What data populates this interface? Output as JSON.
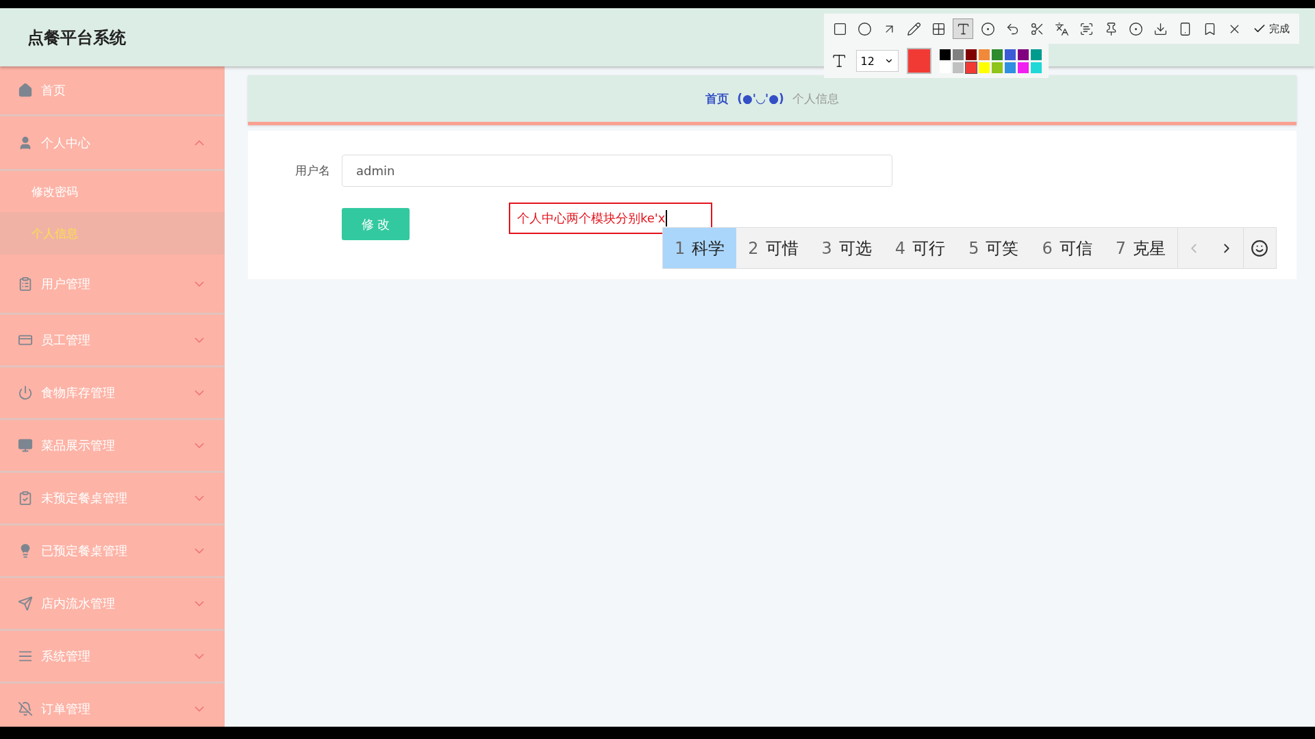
{
  "app": {
    "title": "点餐平台系统"
  },
  "sidebar": {
    "items": [
      {
        "label": "首页",
        "expanded": false
      },
      {
        "label": "个人中心",
        "expanded": true,
        "children": [
          {
            "label": "修改密码",
            "selected": false
          },
          {
            "label": "个人信息",
            "selected": true
          }
        ]
      },
      {
        "label": "用户管理",
        "expanded": false
      },
      {
        "label": "员工管理",
        "expanded": false
      },
      {
        "label": "食物库存管理",
        "expanded": false
      },
      {
        "label": "菜品展示管理",
        "expanded": false
      },
      {
        "label": "未预定餐桌管理",
        "expanded": false
      },
      {
        "label": "已预定餐桌管理",
        "expanded": false
      },
      {
        "label": "店内流水管理",
        "expanded": false
      },
      {
        "label": "系统管理",
        "expanded": false
      },
      {
        "label": "订单管理",
        "expanded": false
      }
    ]
  },
  "breadcrumb": {
    "home": "首页",
    "separator": "(●'◡'●)",
    "current": "个人信息"
  },
  "form": {
    "label": "用户名",
    "value": "admin",
    "button": "修 改"
  },
  "annotation": {
    "text": "个人中心两个模块分别ke'x"
  },
  "ime": {
    "candidates": [
      {
        "index": "1",
        "text": "科学",
        "selected": true
      },
      {
        "index": "2",
        "text": "可惜",
        "selected": false
      },
      {
        "index": "3",
        "text": "可选",
        "selected": false
      },
      {
        "index": "4",
        "text": "可行",
        "selected": false
      },
      {
        "index": "5",
        "text": "可笑",
        "selected": false
      },
      {
        "index": "6",
        "text": "可信",
        "selected": false
      },
      {
        "index": "7",
        "text": "克星",
        "selected": false
      }
    ]
  },
  "capture_toolbar": {
    "tools": [
      {
        "selected": false
      },
      {
        "selected": false
      },
      {
        "selected": false
      },
      {
        "selected": false
      },
      {
        "selected": false
      },
      {
        "selected": true
      },
      {
        "selected": false
      }
    ],
    "done": "完成",
    "font_size": "12",
    "swatches": [
      {
        "color": "#000000",
        "selected": false
      },
      {
        "color": "#808080",
        "selected": false
      },
      {
        "color": "#800000",
        "selected": false
      },
      {
        "color": "#f08a3a",
        "selected": false
      },
      {
        "color": "#2e8b2e",
        "selected": false
      },
      {
        "color": "#3b5bd6",
        "selected": false
      },
      {
        "color": "#800080",
        "selected": false
      },
      {
        "color": "#009b8f",
        "selected": false
      },
      {
        "color": "#ffffff",
        "selected": false
      },
      {
        "color": "#c0c0c0",
        "selected": false
      },
      {
        "color": "#f23a35",
        "selected": true
      },
      {
        "color": "#ffff00",
        "selected": false
      },
      {
        "color": "#8fc41a",
        "selected": false
      },
      {
        "color": "#2f8fe0",
        "selected": false
      },
      {
        "color": "#f020f0",
        "selected": false
      },
      {
        "color": "#20d8d8",
        "selected": false
      }
    ]
  }
}
